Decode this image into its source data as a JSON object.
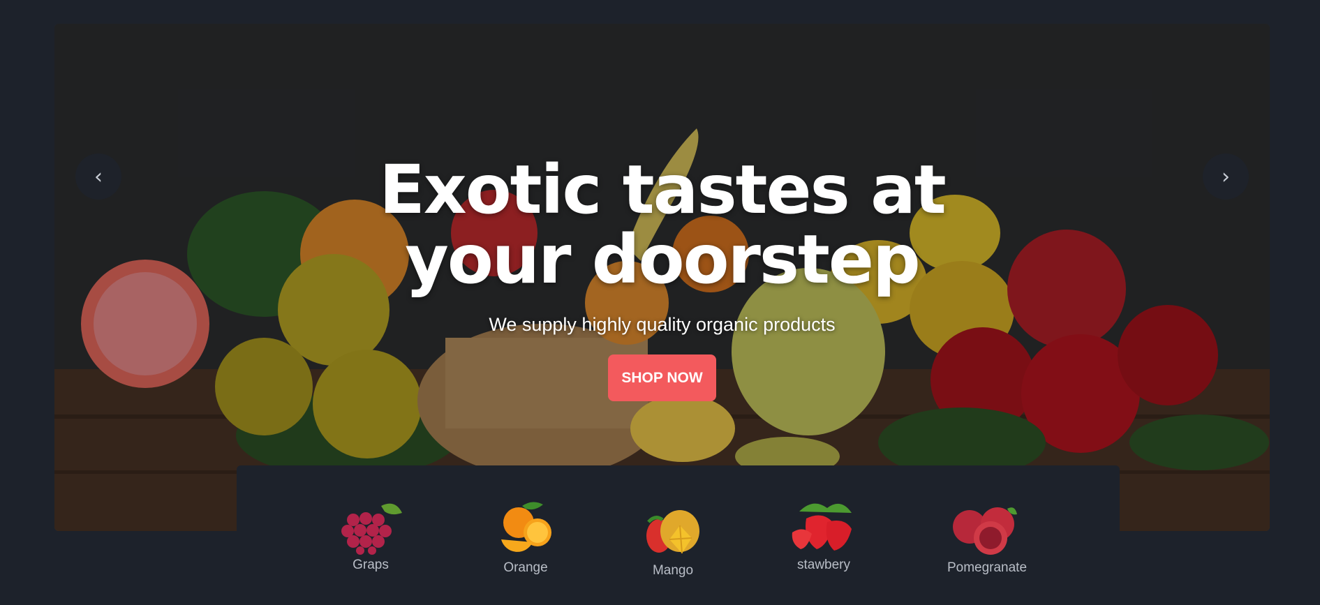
{
  "hero": {
    "headline": "Exotic tastes at your doorstep",
    "subtitle": "We supply highly quality organic products",
    "cta_label": "SHOP NOW",
    "prev_arrow": "‹",
    "next_arrow": "›"
  },
  "categories": [
    {
      "label": "Graps",
      "icon": "grapes-icon"
    },
    {
      "label": "Orange",
      "icon": "orange-icon"
    },
    {
      "label": "Mango",
      "icon": "mango-icon"
    },
    {
      "label": "stawbery",
      "icon": "strawberry-icon"
    },
    {
      "label": "Pomegranate",
      "icon": "pomegranate-icon"
    }
  ],
  "colors": {
    "background": "#1d222b",
    "cta": "#f35a5d",
    "text": "#ffffff",
    "category_text": "#b9bec7"
  }
}
